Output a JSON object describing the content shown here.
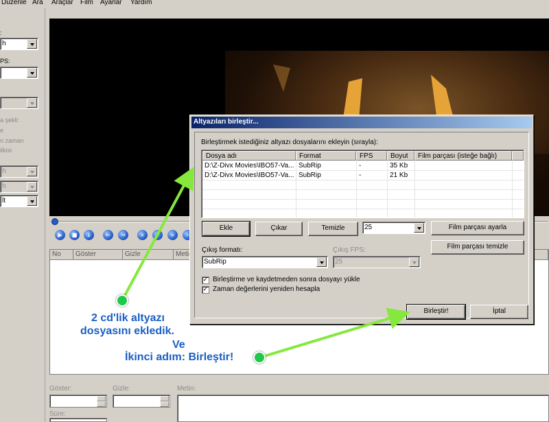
{
  "menu": [
    "Düzenle",
    "Ara",
    "Araçlar",
    "Film",
    "Ayarlar",
    "Yardım"
  ],
  "left_panel": {
    "labels": [
      ":",
      "PS:",
      "a şekli:",
      "e",
      "n zaman",
      "ilkisi"
    ],
    "combos": [
      "h",
      "",
      "",
      "h",
      "h",
      "lt"
    ]
  },
  "subtitle_list": {
    "columns": [
      "No",
      "Göster",
      "Gizle",
      "Metin"
    ]
  },
  "bottom_edit": {
    "show_label": "Göster:",
    "hide_label": "Gizle:",
    "text_label": "Metin:",
    "duration_label": "Süre:"
  },
  "dialog": {
    "title": "Altyazıları birleştir...",
    "instruction": "Birleştirmek istediğiniz altyazı dosyalarını ekleyin (sırayla):",
    "columns": [
      "Dosya adı",
      "Format",
      "FPS",
      "Boyut",
      "Film parçası (isteğe bağlı)"
    ],
    "files": [
      {
        "name": "D:\\Z-Divx Movies\\IBO57-Va...",
        "format": "SubRip",
        "fps": "-",
        "size": "35 Kb",
        "part": ""
      },
      {
        "name": "D:\\Z-Divx Movies\\IBO57-Va...",
        "format": "SubRip",
        "fps": "-",
        "size": "21 Kb",
        "part": ""
      }
    ],
    "add_button": "Ekle",
    "remove_button": "Çıkar",
    "clear_button": "Temizle",
    "fps_value": "25",
    "set_part_button": "Film parçası ayarla",
    "clear_part_button": "Film parçası temizle",
    "output_format_label": "Çıkış formatı:",
    "output_format_value": "SubRip",
    "output_fps_label": "Çıkış FPS:",
    "output_fps_value": "25",
    "load_after_label": "Birleştirme ve kaydetmeden sonra dosyayı yükle",
    "load_after_checked": true,
    "recalc_label": "Zaman değerlerini yeniden hesapla",
    "recalc_checked": true,
    "merge_button": "Birleştir!",
    "cancel_button": "İptal"
  },
  "annotations": {
    "note1_line1": "2 cd'lik altyazı",
    "note1_line2": "dosyasını ekledik.",
    "note2_line1": "Ve",
    "note2_line2": "İkinci adım: Birleştir!",
    "arrow_color": "#86e83c",
    "dot_color": "#1ec94a"
  }
}
